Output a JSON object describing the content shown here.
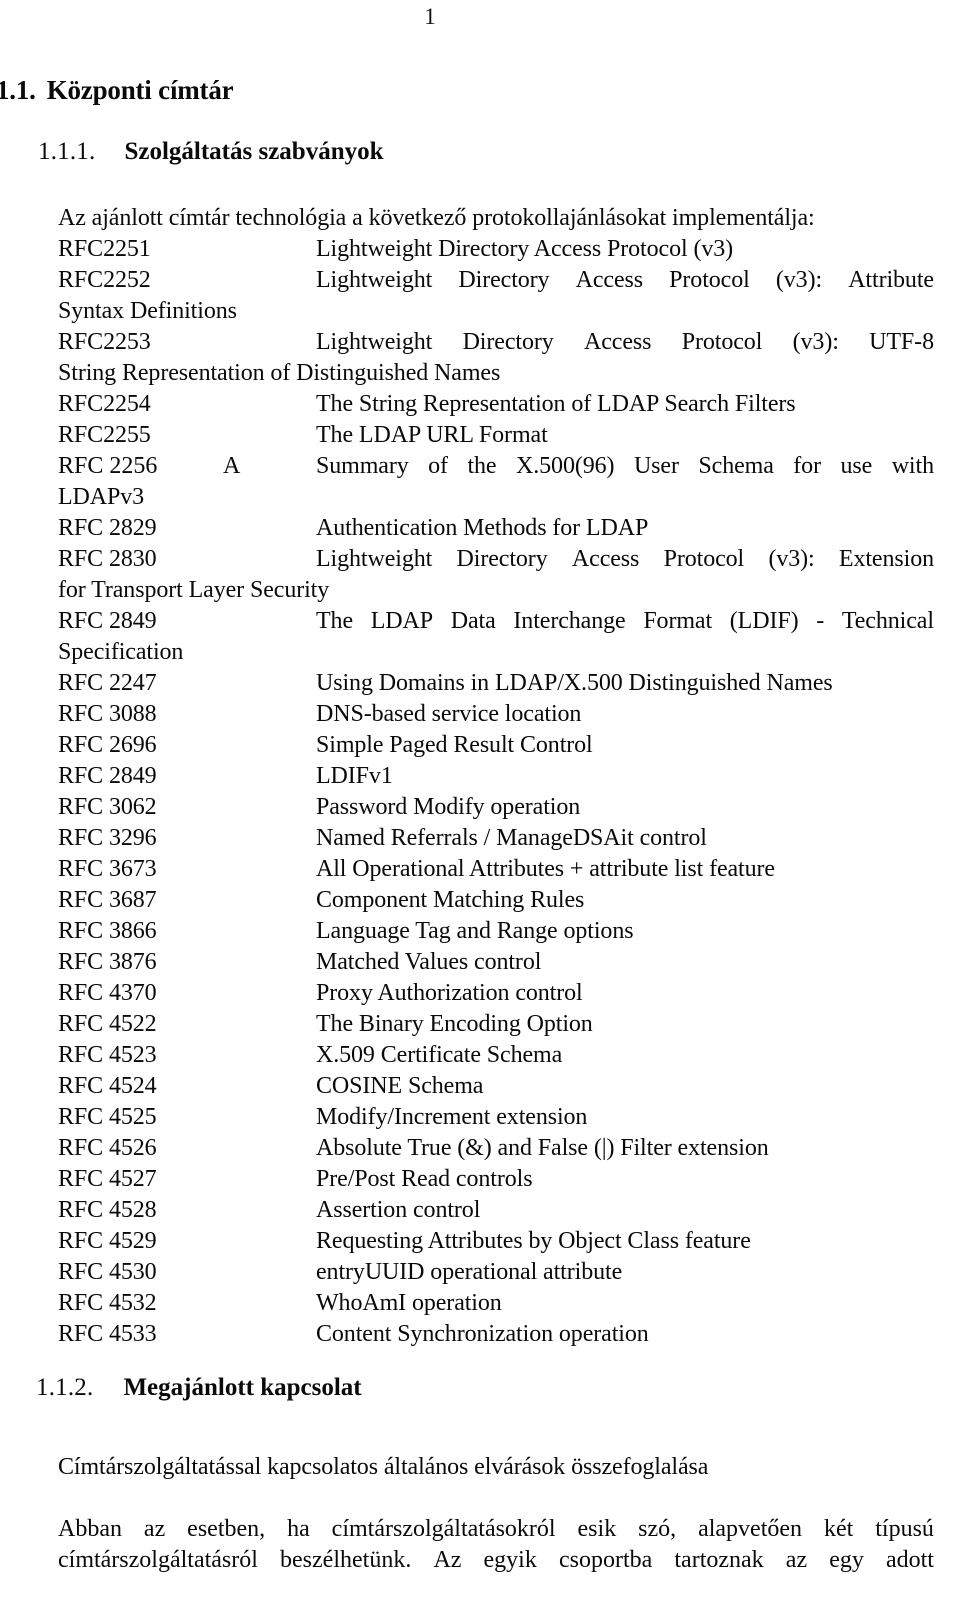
{
  "page": {
    "number": "1"
  },
  "headings": {
    "section": {
      "number": "1.1.",
      "title": "Központi címtár"
    },
    "subsection_1": {
      "number": "1.1.1.",
      "title": "Szolgáltatás szabványok"
    },
    "subsection_2": {
      "number": "1.1.2.",
      "title": "Megajánlott kapcsolat"
    }
  },
  "intro": "Az ajánlott címtár technológia a következő protokollajánlásokat implementálja:",
  "rfc_list": [
    {
      "id": "RFC2251",
      "desc": "Lightweight Directory Access Protocol (v3)",
      "justified": false,
      "words": [],
      "continuation": ""
    },
    {
      "id": "RFC2252",
      "desc": "Lightweight Directory Access Protocol (v3): Attribute",
      "justified": true,
      "words": [
        "Lightweight",
        "Directory",
        "Access",
        "Protocol",
        "(v3):",
        "Attribute"
      ],
      "continuation": "Syntax Definitions"
    },
    {
      "id": "RFC2253",
      "desc": "Lightweight Directory Access Protocol (v3): UTF-8",
      "justified": true,
      "words": [
        "Lightweight",
        "Directory",
        "Access",
        "Protocol",
        "(v3):",
        "UTF-8"
      ],
      "continuation": "String Representation of Distinguished Names"
    },
    {
      "id": "RFC2254",
      "desc": "The String Representation of LDAP Search Filters",
      "justified": false,
      "words": [],
      "continuation": ""
    },
    {
      "id": "RFC2255",
      "desc": "The LDAP URL Format",
      "justified": false,
      "words": [],
      "continuation": ""
    },
    {
      "id": "RFC 2256",
      "gutter": "A",
      "desc": "Summary of the X.500(96) User Schema for use with",
      "justified": true,
      "words": [
        "Summary",
        "of",
        "the",
        "X.500(96)",
        "User",
        "Schema",
        "for",
        "use",
        "with"
      ],
      "continuation": "LDAPv3"
    },
    {
      "id": "RFC 2829",
      "desc": "Authentication Methods for LDAP",
      "justified": false,
      "words": [],
      "continuation": ""
    },
    {
      "id": "RFC 2830",
      "desc": "Lightweight Directory Access Protocol (v3): Extension",
      "justified": true,
      "words": [
        "Lightweight",
        "Directory",
        "Access",
        "Protocol",
        "(v3):",
        "Extension"
      ],
      "continuation": "for Transport Layer Security"
    },
    {
      "id": "RFC 2849",
      "desc": "The LDAP Data Interchange Format (LDIF) - Technical",
      "justified": true,
      "words": [
        "The",
        "LDAP",
        "Data",
        "Interchange",
        "Format",
        "(LDIF)",
        "-",
        "Technical"
      ],
      "continuation": "Specification"
    },
    {
      "id": "RFC 2247",
      "desc": "Using Domains in LDAP/X.500 Distinguished Names",
      "justified": false,
      "words": [],
      "continuation": ""
    },
    {
      "id": "RFC 3088",
      "desc": "DNS-based service location",
      "justified": false,
      "words": [],
      "continuation": ""
    },
    {
      "id": "RFC 2696",
      "desc": "Simple Paged Result Control",
      "justified": false,
      "words": [],
      "continuation": ""
    },
    {
      "id": "RFC 2849",
      "desc": "LDIFv1",
      "justified": false,
      "words": [],
      "continuation": ""
    },
    {
      "id": "RFC 3062",
      "desc": "Password Modify operation",
      "justified": false,
      "words": [],
      "continuation": ""
    },
    {
      "id": "RFC 3296",
      "desc": "Named Referrals / ManageDSAit control",
      "justified": false,
      "words": [],
      "continuation": ""
    },
    {
      "id": "RFC 3673",
      "desc": "All Operational Attributes + attribute list feature",
      "justified": false,
      "words": [],
      "continuation": ""
    },
    {
      "id": "RFC 3687",
      "desc": "Component Matching Rules",
      "justified": false,
      "words": [],
      "continuation": ""
    },
    {
      "id": "RFC 3866",
      "desc": "Language Tag and Range options",
      "justified": false,
      "words": [],
      "continuation": ""
    },
    {
      "id": "RFC 3876",
      "desc": "Matched Values control",
      "justified": false,
      "words": [],
      "continuation": ""
    },
    {
      "id": "RFC 4370",
      "desc": "Proxy Authorization control",
      "justified": false,
      "words": [],
      "continuation": ""
    },
    {
      "id": "RFC 4522",
      "desc": "The Binary Encoding Option",
      "justified": false,
      "words": [],
      "continuation": ""
    },
    {
      "id": "RFC 4523",
      "desc": "X.509 Certificate Schema",
      "justified": false,
      "words": [],
      "continuation": ""
    },
    {
      "id": "RFC 4524",
      "desc": "COSINE Schema",
      "justified": false,
      "words": [],
      "continuation": ""
    },
    {
      "id": "RFC 4525",
      "desc": "Modify/Increment extension",
      "justified": false,
      "words": [],
      "continuation": ""
    },
    {
      "id": "RFC 4526",
      "desc": "Absolute True (&) and False (|) Filter extension",
      "justified": false,
      "words": [],
      "continuation": ""
    },
    {
      "id": "RFC 4527",
      "desc": "Pre/Post Read controls",
      "justified": false,
      "words": [],
      "continuation": ""
    },
    {
      "id": "RFC 4528",
      "desc": "Assertion control",
      "justified": false,
      "words": [],
      "continuation": ""
    },
    {
      "id": "RFC 4529",
      "desc": "Requesting Attributes by Object Class feature",
      "justified": false,
      "words": [],
      "continuation": ""
    },
    {
      "id": "RFC 4530",
      "desc": "entryUUID operational attribute",
      "justified": false,
      "words": [],
      "continuation": ""
    },
    {
      "id": "RFC 4532",
      "desc": "WhoAmI operation",
      "justified": false,
      "words": [],
      "continuation": ""
    },
    {
      "id": "RFC 4533",
      "desc": "Content Synchronization operation",
      "justified": false,
      "words": [],
      "continuation": ""
    }
  ],
  "summary_paragraph": "Címtárszolgáltatással kapcsolatos általános elvárások összefoglalása",
  "closing_paragraph": {
    "line1_words": [
      "Abban",
      "az",
      "esetben,",
      "ha",
      "címtárszolgáltatásokról",
      "esik",
      "szó,",
      "alapvetően",
      "két",
      "típusú"
    ],
    "line2_words": [
      "címtárszolgáltatásról",
      "beszélhetünk.",
      "Az",
      "egyik",
      "csoportba",
      "tartoznak",
      "az",
      "egy",
      "adott"
    ]
  }
}
